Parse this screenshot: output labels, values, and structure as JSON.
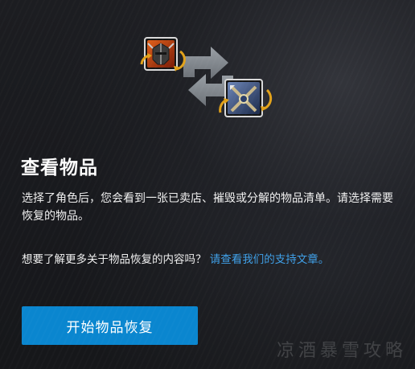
{
  "heading": {
    "title": "查看物品"
  },
  "description": "选择了角色后，您会看到一张已卖店、摧毁或分解的物品清单。请选择需要恢复的物品。",
  "help": {
    "prompt": "想要了解更多关于物品恢复的内容吗？",
    "link_text": "请查看我们的支持文章。"
  },
  "actions": {
    "start_label": "开始物品恢复"
  },
  "watermark": "凉酒暴雪攻略",
  "icons": {
    "hero_swap": "swap-arrows-icon",
    "helmet_item": "helmet-item-icon",
    "weapon_item": "crossed-weapon-item-icon",
    "restore_badge": "circular-arrow-icon"
  },
  "colors": {
    "accent": "#0a86cf",
    "link": "#3fa0e8",
    "badge_gold": "#e2a21a",
    "background": "#18191d"
  }
}
